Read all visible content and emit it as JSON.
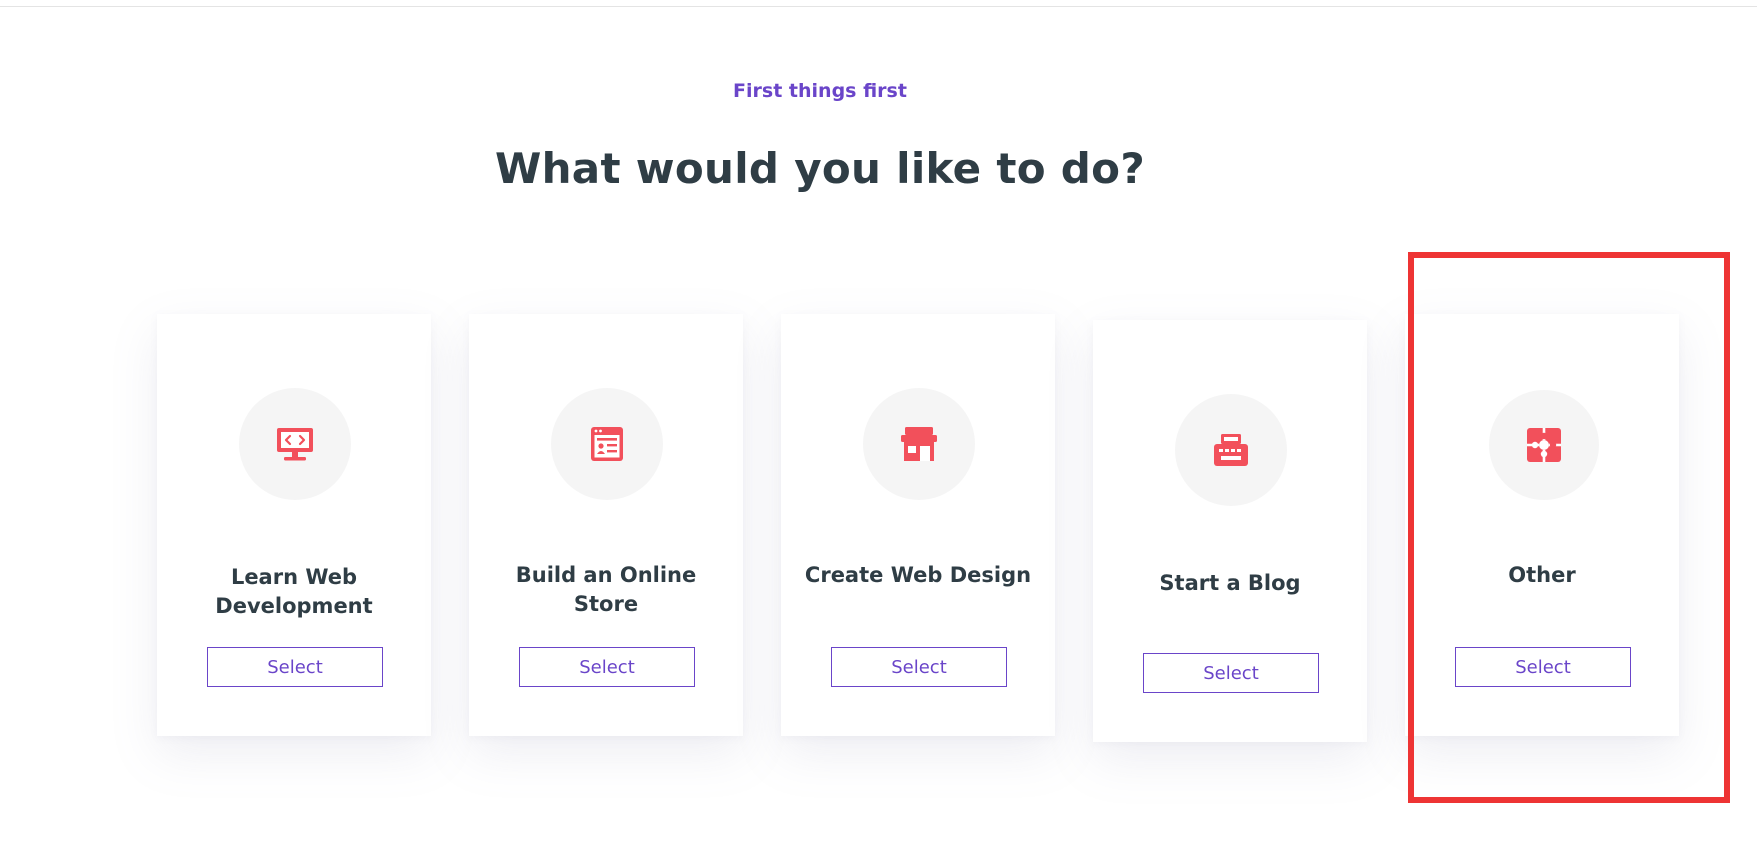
{
  "header": {
    "eyebrow": "First things first",
    "title": "What would you like to do?"
  },
  "cards": [
    {
      "title": "Learn Web Development",
      "button_label": "Select",
      "icon": "monitor-code-icon"
    },
    {
      "title": "Build an Online Store",
      "button_label": "Select",
      "icon": "browser-window-icon"
    },
    {
      "title": "Create Web Design",
      "button_label": "Select",
      "icon": "storefront-icon"
    },
    {
      "title": "Start a Blog",
      "button_label": "Select",
      "icon": "typewriter-icon"
    },
    {
      "title": "Other",
      "button_label": "Select",
      "icon": "puzzle-icon"
    }
  ],
  "colors": {
    "accent": "#6a45c9",
    "icon": "#f2505b",
    "heading": "#2f3d45",
    "highlight": "#ee3434"
  }
}
